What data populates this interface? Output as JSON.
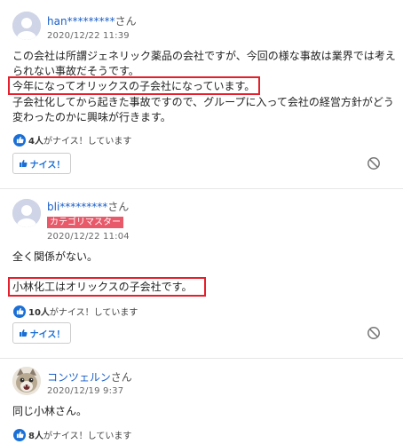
{
  "comments": [
    {
      "username": "han*********",
      "suffix": "さん",
      "date": "2020/12/22 11:39",
      "lines": [
        "この会社は所謂ジェネリック薬品の会社ですが、今回の様な事故は業界では考え",
        "られない事故だそうです。",
        "今年になってオリックスの子会社になっています。",
        "子会社化してから起きた事故ですので、グループに入って会社の経営方針がどう",
        "変わったのかに興味が行きます。"
      ],
      "likes_count": "4人",
      "likes_text": "がナイス！しています",
      "nice_label": "ナイス！",
      "avatar": "default-avatar"
    },
    {
      "username": "bli*********",
      "suffix": "さん",
      "badge": "カテゴリマスター",
      "date": "2020/12/22 11:04",
      "lines": [
        "全く関係がない。",
        "小林化工はオリックスの子会社です。"
      ],
      "likes_count": "10人",
      "likes_text": "がナイス！しています",
      "nice_label": "ナイス！",
      "avatar": "default-avatar"
    },
    {
      "username": "コンツェルン",
      "suffix": "さん",
      "date": "2020/12/19 9:37",
      "lines": [
        "同じ小林さん。"
      ],
      "likes_count": "8人",
      "likes_text": "がナイス！しています",
      "avatar": "cat-avatar"
    }
  ],
  "colors": {
    "link": "#1a5fc9",
    "accent": "#1a6fd6",
    "highlight": "#e5202c",
    "badge": "#e8596a"
  }
}
